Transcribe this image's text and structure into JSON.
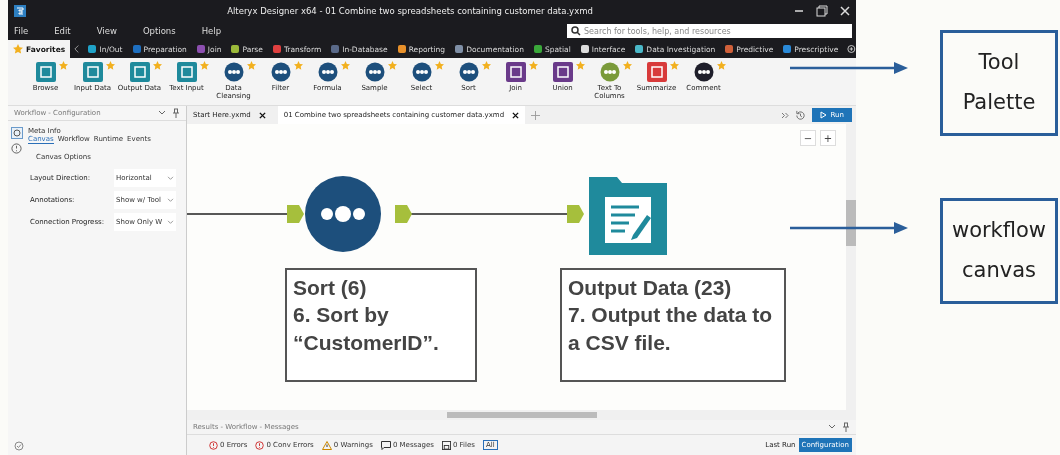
{
  "window": {
    "title": "Alteryx Designer x64 - 01 Combine two spreadsheets containing customer data.yxmd"
  },
  "menu": [
    "File",
    "Edit",
    "View",
    "Options",
    "Help"
  ],
  "search": {
    "placeholder": "Search for tools, help, and resources"
  },
  "categories": [
    {
      "label": "Favorites",
      "selected": true,
      "color": "#f2b01e"
    },
    {
      "label": "In/Out",
      "selected": false,
      "color": "#1fa2c8"
    },
    {
      "label": "Preparation",
      "selected": false,
      "color": "#1e6fc0"
    },
    {
      "label": "Join",
      "selected": false,
      "color": "#8c4fb0"
    },
    {
      "label": "Parse",
      "selected": false,
      "color": "#9bb93a"
    },
    {
      "label": "Transform",
      "selected": false,
      "color": "#e04040"
    },
    {
      "label": "In-Database",
      "selected": false,
      "color": "#5a6a8a"
    },
    {
      "label": "Reporting",
      "selected": false,
      "color": "#e8902a"
    },
    {
      "label": "Documentation",
      "selected": false,
      "color": "#7f8fa6"
    },
    {
      "label": "Spatial",
      "selected": false,
      "color": "#3aa83a"
    },
    {
      "label": "Interface",
      "selected": false,
      "color": "#dddddd"
    },
    {
      "label": "Data Investigation",
      "selected": false,
      "color": "#4ab8c8"
    },
    {
      "label": "Predictive",
      "selected": false,
      "color": "#d0603a"
    },
    {
      "label": "Prescriptive",
      "selected": false,
      "color": "#2a8ad8"
    }
  ],
  "tools": [
    {
      "label": "Browse",
      "kind": "square",
      "color": "#1f8a9c"
    },
    {
      "label": "Input Data",
      "kind": "square",
      "color": "#1f8a9c"
    },
    {
      "label": "Output Data",
      "kind": "square",
      "color": "#1f8a9c"
    },
    {
      "label": "Text Input",
      "kind": "square",
      "color": "#1f8a9c"
    },
    {
      "label": "Data Cleansing",
      "kind": "circle",
      "color": "#1d4f7c"
    },
    {
      "label": "Filter",
      "kind": "circle",
      "color": "#1d4f7c"
    },
    {
      "label": "Formula",
      "kind": "circle",
      "color": "#1d4f7c"
    },
    {
      "label": "Sample",
      "kind": "circle",
      "color": "#1d4f7c"
    },
    {
      "label": "Select",
      "kind": "circle",
      "color": "#1d4f7c"
    },
    {
      "label": "Sort",
      "kind": "circle",
      "color": "#1d4f7c"
    },
    {
      "label": "Join",
      "kind": "square",
      "color": "#6a3a8a"
    },
    {
      "label": "Union",
      "kind": "square",
      "color": "#6a3a8a"
    },
    {
      "label": "Text To Columns",
      "kind": "circle",
      "color": "#7a9a3a"
    },
    {
      "label": "Summarize",
      "kind": "square",
      "color": "#d83a3a"
    },
    {
      "label": "Comment",
      "kind": "circle",
      "color": "#1e1e2a"
    }
  ],
  "config": {
    "title": "Workflow - Configuration",
    "section": "Meta Info",
    "tabs": [
      {
        "label": "Canvas",
        "selected": true
      },
      {
        "label": "Workflow",
        "selected": false
      },
      {
        "label": "Runtime",
        "selected": false
      },
      {
        "label": "Events",
        "selected": false
      }
    ],
    "heading": "Canvas Options",
    "fields": [
      {
        "label": "Layout Direction:",
        "value": "Horizontal"
      },
      {
        "label": "Annotations:",
        "value": "Show w/ Tool"
      },
      {
        "label": "Connection Progress:",
        "value": "Show Only W"
      }
    ]
  },
  "doc_tabs": [
    {
      "label": "Start Here.yxmd",
      "selected": false
    },
    {
      "label": "01 Combine two spreadsheets containing customer data.yxmd",
      "selected": true
    }
  ],
  "run_button": "Run",
  "zoom_buttons": [
    "−",
    "+"
  ],
  "nodes": [
    {
      "kind": "sort",
      "title": "Sort (6)",
      "note": "6. Sort by “CustomerID”."
    },
    {
      "kind": "output",
      "title": "Output Data (23)",
      "note": "7. Output the data to a CSV file."
    }
  ],
  "results": {
    "title": "Results - Workflow - Messages",
    "counts": [
      {
        "kind": "error",
        "label": "0 Errors"
      },
      {
        "kind": "error",
        "label": "0 Conv Errors"
      },
      {
        "kind": "warning",
        "label": "0 Warnings"
      },
      {
        "kind": "message",
        "label": "0 Messages"
      },
      {
        "kind": "file",
        "label": "0 Files"
      }
    ],
    "filter": "All",
    "views": [
      {
        "label": "Last Run",
        "selected": false
      },
      {
        "label": "Configuration",
        "selected": true
      }
    ]
  },
  "callouts": [
    "Tool Palette",
    "workflow canvas"
  ]
}
